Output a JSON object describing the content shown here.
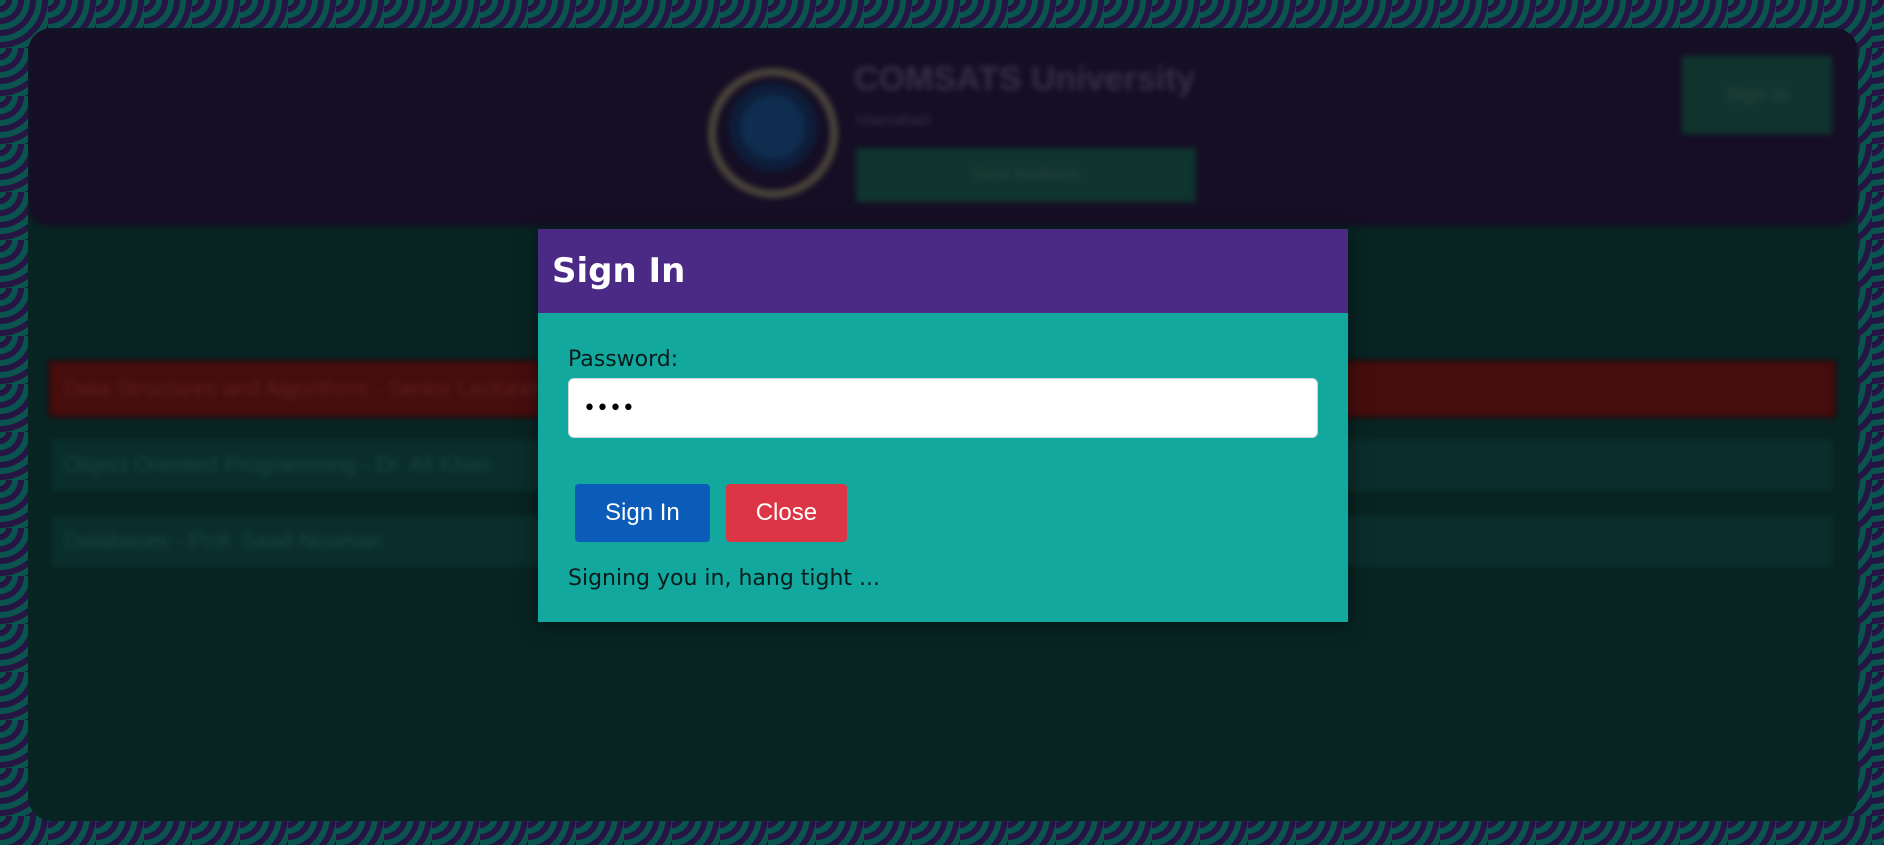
{
  "background_app": {
    "university_name": "COMSATS University",
    "university_subtitle": "Islamabad",
    "header_center_button": "Send feedback",
    "header_signin_button": "Sign In",
    "courses": [
      {
        "label": "Data Structures and Algorithms - Senior Lecturer",
        "highlighted": true
      },
      {
        "label": "Object Oriented Programming - Dr. Ali Khan",
        "highlighted": false
      },
      {
        "label": "Databases - Prof. Saad Nouman",
        "highlighted": false
      }
    ]
  },
  "modal": {
    "title": "Sign In",
    "password_label": "Password:",
    "password_value": "••••",
    "signin_button": "Sign In",
    "close_button": "Close",
    "status": "Signing you in, hang tight ..."
  },
  "colors": {
    "modal_header": "#4b2a86",
    "modal_body": "#12a89e",
    "primary_button": "#0a5cb8",
    "danger_button": "#dc3545"
  }
}
